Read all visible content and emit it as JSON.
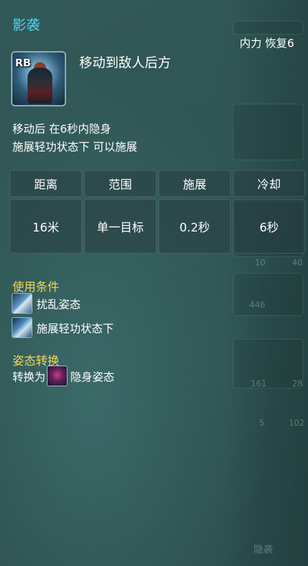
{
  "tooltip": {
    "title": "影袭",
    "resource": "内力 恢复6",
    "skill": {
      "badge": "RB",
      "name": "移动到敌人后方",
      "icon": "shadow-assassin-icon"
    },
    "description": [
      "移动后 在6秒内隐身",
      "施展轻功状态下 可以施展"
    ],
    "stats": {
      "headers": [
        "距离",
        "范围",
        "施展",
        "冷却"
      ],
      "values": [
        "16米",
        "单一目标",
        "0.2秒",
        "6秒"
      ]
    },
    "conditions": {
      "heading": "使用条件",
      "items": [
        {
          "label": "扰乱姿态",
          "icon": "disrupt-stance-icon"
        },
        {
          "label": "施展轻功状态下",
          "icon": "lightness-skill-icon"
        }
      ]
    },
    "stance_change": {
      "heading": "姿态转换",
      "prefix": "转换为",
      "label": "隐身姿态",
      "icon": "stealth-stance-icon"
    }
  },
  "background_hud": {
    "counts": [
      "10",
      "40",
      "446",
      "161",
      "28",
      "5",
      "102"
    ],
    "footer": "隐袭"
  },
  "colors": {
    "title": "#4fd4f0",
    "heading": "#f2d65a",
    "text": "#ffffff"
  }
}
